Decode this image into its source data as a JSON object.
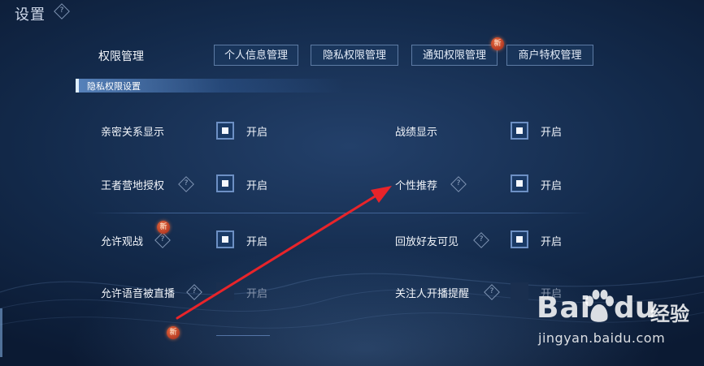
{
  "header": {
    "title": "设置",
    "help_icon": "question-diamond-icon"
  },
  "permission": {
    "label": "权限管理",
    "tabs": [
      {
        "label": "个人信息管理"
      },
      {
        "label": "隐私权限管理"
      },
      {
        "label": "通知权限管理",
        "badge": "新"
      },
      {
        "label": "商户特权管理"
      }
    ]
  },
  "section": {
    "title": "隐私权限设置"
  },
  "settings": [
    {
      "label": "亲密关系显示",
      "state": "开启",
      "checked": true
    },
    {
      "label": "战绩显示",
      "state": "开启",
      "checked": true
    },
    {
      "label": "王者营地授权",
      "state": "开启",
      "checked": true,
      "help": "?"
    },
    {
      "label": "个性推荐",
      "state": "开启",
      "checked": true,
      "help": "?"
    },
    {
      "label": "允许观战",
      "state": "开启",
      "checked": true,
      "help": "?",
      "badge": "新"
    },
    {
      "label": "回放好友可见",
      "state": "开启",
      "checked": true,
      "help": "?"
    },
    {
      "label": "允许语音被直播",
      "state": "开启",
      "checked": false,
      "help": "?"
    },
    {
      "label": "关注人开播提醒",
      "state": "开启",
      "checked": false,
      "help": "?"
    }
  ],
  "partial_row": {
    "badge": "新"
  },
  "annotation": {
    "color": "#e8242a"
  },
  "watermark": {
    "brand_left": "Bai",
    "brand_right": "du",
    "brand_cn": "经验",
    "url": "jingyan.baidu.com"
  }
}
